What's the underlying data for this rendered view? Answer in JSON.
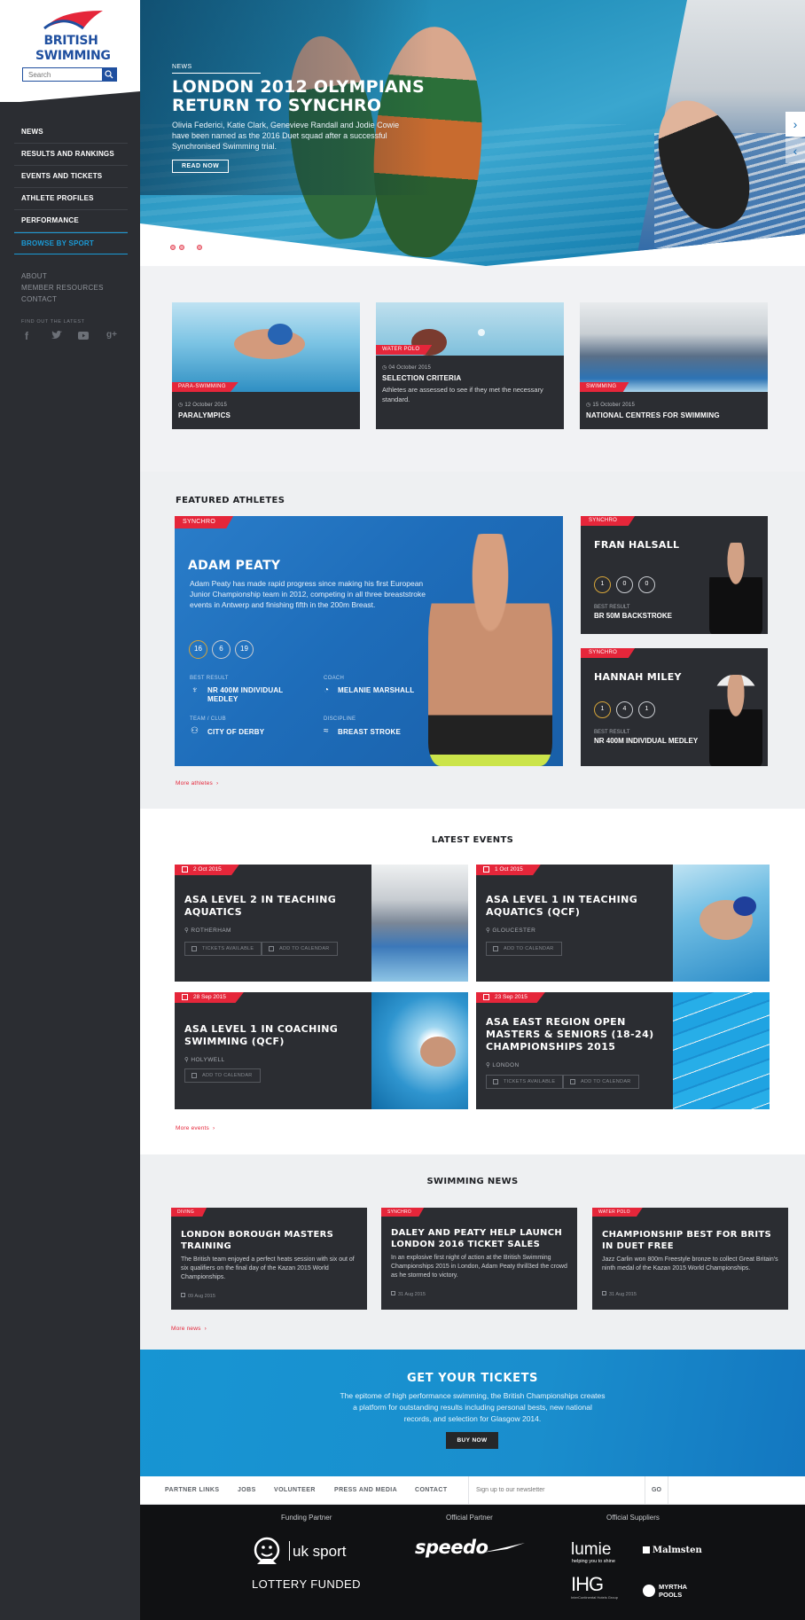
{
  "sidebar": {
    "brand_line1": "BRITISH",
    "brand_line2": "SWIMMING",
    "search_placeholder": "Search",
    "nav": [
      "NEWS",
      "RESULTS AND RANKINGS",
      "EVENTS AND TICKETS",
      "ATHLETE PROFILES",
      "PERFORMANCE",
      "BROWSE BY SPORT"
    ],
    "secondary": [
      "ABOUT",
      "MEMBER RESOURCES",
      "CONTACT"
    ],
    "find_latest": "FIND OUT THE LATEST",
    "socials": [
      "facebook-icon",
      "twitter-icon",
      "youtube-icon",
      "google-plus-icon"
    ]
  },
  "hero": {
    "tag": "NEWS",
    "title": "LONDON 2012 OLYMPIANS RETURN TO SYNCHRO",
    "description": "Olivia Federici, Katie Clark, Genevieve Randall and Jodie Cowie have been named as the 2016 Duet squad after a successful Synchronised Swimming trial.",
    "button": "READ NOW"
  },
  "news_cards": [
    {
      "tag": "PARA-SWIMMING",
      "date": "12 October 2015",
      "title": "PARALYMPICS",
      "desc": ""
    },
    {
      "tag": "WATER POLO",
      "date": "04 October 2015",
      "title": "SELECTION CRITERIA",
      "desc": "Athletes are assessed to see if they met the necessary standard."
    },
    {
      "tag": "SWIMMING",
      "date": "15 October 2015",
      "title": "NATIONAL CENTRES FOR SWIMMING",
      "desc": ""
    }
  ],
  "featured": {
    "title": "FEATURED ATHLETES",
    "main": {
      "tag": "SYNCHRO",
      "name": "ADAM PEATY",
      "bio": "Adam Peaty has made rapid progress since making his first European Junior Championship team in 2012, competing in all three breaststroke events in Antwerp and finishing fifth in the 200m Breast.",
      "medals": [
        "16",
        "6",
        "19"
      ],
      "best_result_label": "BEST RESULT",
      "best_result": "NR 400M INDIVIDUAL MEDLEY",
      "coach_label": "COACH",
      "coach": "MELANIE MARSHALL",
      "club_label": "TEAM / CLUB",
      "club": "CITY OF DERBY",
      "discipline_label": "DISCIPLINE",
      "discipline": "BREAST STROKE"
    },
    "side": [
      {
        "tag": "SYNCHRO",
        "name": "FRAN HALSALL",
        "medals": [
          "1",
          "0",
          "0"
        ],
        "best_label": "BEST RESULT",
        "best": "BR 50M BACKSTROKE"
      },
      {
        "tag": "SYNCHRO",
        "name": "HANNAH MILEY",
        "medals": [
          "1",
          "4",
          "1"
        ],
        "best_label": "BEST RESULT",
        "best": "NR 400M INDIVIDUAL MEDLEY"
      }
    ],
    "more": "More athletes"
  },
  "events": {
    "title": "LATEST EVENTS",
    "items": [
      {
        "date": "2 Oct 2015",
        "title": "ASA LEVEL 2 IN TEACHING AQUATICS",
        "location": "ROTHERHAM",
        "buttons": [
          "TICKETS AVAILABLE",
          "ADD TO CALENDAR"
        ]
      },
      {
        "date": "1 Oct 2015",
        "title": "ASA LEVEL 1 IN TEACHING AQUATICS (QCF)",
        "location": "GLOUCESTER",
        "buttons": [
          "ADD TO CALENDAR"
        ]
      },
      {
        "date": "28 Sep 2015",
        "title": "ASA LEVEL 1 IN COACHING SWIMMING (QCF)",
        "location": "HOLYWELL",
        "buttons": [
          "ADD TO CALENDAR"
        ]
      },
      {
        "date": "23 Sep 2015",
        "title": "ASA EAST REGION OPEN MASTERS & SENIORS (18-24) CHAMPIONSHIPS 2015",
        "location": "LONDON",
        "buttons": [
          "TICKETS AVAILABLE",
          "ADD TO CALENDAR"
        ]
      }
    ],
    "more": "More events"
  },
  "swimming_news": {
    "title": "SWIMMING NEWS",
    "items": [
      {
        "tag": "DIVING",
        "title": "LONDON BOROUGH MASTERS TRAINING",
        "text": "The British team enjoyed a perfect heats session with six out of six qualifiers on the final day of the Kazan 2015 World Championships.",
        "date": "09 Aug 2015"
      },
      {
        "tag": "SYNCHRO",
        "title": "DALEY AND PEATY HELP LAUNCH LONDON 2016 TICKET SALES",
        "text": "In an explosive first night of action at the British Swimming Championships 2015 in London, Adam Peaty thrill3ed the crowd as he stormed to victory.",
        "date": "31 Aug 2015"
      },
      {
        "tag": "WATER POLO",
        "title": "CHAMPIONSHIP BEST FOR BRITS IN DUET FREE",
        "text": "Jazz Carlin won 800m Freestyle bronze to collect Great Britain's ninth medal of the Kazan 2015 World Championships.",
        "date": "31 Aug 2015"
      }
    ],
    "more": "More news"
  },
  "tickets": {
    "title": "GET YOUR TICKETS",
    "description": "The epitome of high performance swimming, the British Championships creates a platform for outstanding results including personal bests, new national records, and selection for Glasgow 2014.",
    "button": "BUY NOW"
  },
  "footer": {
    "links": [
      "PARTNER LINKS",
      "JOBS",
      "VOLUNTEER",
      "PRESS AND MEDIA",
      "CONTACT"
    ],
    "newsletter_placeholder": "Sign up to our newsletter",
    "go": "GO",
    "funding_label": "Funding Partner",
    "official_label": "Official Partner",
    "suppliers_label": "Official Suppliers",
    "uk_sport": "uk sport",
    "lottery": "LOTTERY FUNDED",
    "speedo": "speedo",
    "lumie": "lumie",
    "lumie_sub": "helping you to shine",
    "malmsten": "Malmsten",
    "ihg": "IHG",
    "ihg_sub": "InterContinental Hotels Group",
    "myrtha": "MYRTHA POOLS"
  },
  "colors": {
    "accent": "#e5263a",
    "brand_blue": "#1f4f9f",
    "link_blue": "#1b9ad6",
    "dark_card": "#2b2d32"
  }
}
